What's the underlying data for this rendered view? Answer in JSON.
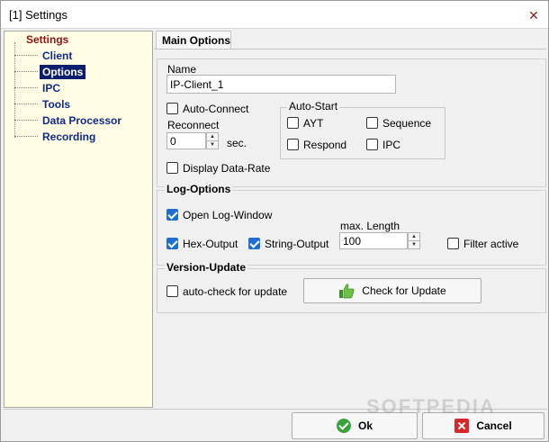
{
  "window": {
    "title": "[1] Settings"
  },
  "tree": {
    "root": "Settings",
    "items": [
      "Client",
      "Options",
      "IPC",
      "Tools",
      "Data Processor",
      "Recording"
    ],
    "selected": "Options"
  },
  "tabs": [
    {
      "label": "Main Options"
    }
  ],
  "main": {
    "name_label": "Name",
    "name_value": "IP-Client_1",
    "auto_connect": {
      "label": "Auto-Connect",
      "checked": false
    },
    "reconnect_label": "Reconnect",
    "reconnect_value": "0",
    "reconnect_unit": "sec.",
    "display_data_rate": {
      "label": "Display Data-Rate",
      "checked": false
    },
    "auto_start": {
      "title": "Auto-Start",
      "ayt": {
        "label": "AYT",
        "checked": false
      },
      "sequence": {
        "label": "Sequence",
        "checked": false
      },
      "respond": {
        "label": "Respond",
        "checked": false
      },
      "ipc": {
        "label": "IPC",
        "checked": false
      }
    }
  },
  "log": {
    "title": "Log-Options",
    "open_log_window": {
      "label": "Open Log-Window",
      "checked": true
    },
    "hex_output": {
      "label": "Hex-Output",
      "checked": true
    },
    "string_output": {
      "label": "String-Output",
      "checked": true
    },
    "max_length_label": "max. Length",
    "max_length_value": "100",
    "filter_active": {
      "label": "Filter active",
      "checked": false
    }
  },
  "update": {
    "title": "Version-Update",
    "auto_check": {
      "label": "auto-check for update",
      "checked": false
    },
    "check_button": "Check for Update"
  },
  "buttons": {
    "ok": "Ok",
    "cancel": "Cancel"
  },
  "watermark": "SOFTPEDIA",
  "colors": {
    "tree_bg": "#fffde3",
    "selection": "#0c1f6e",
    "tree_root": "#8c1414",
    "tree_item": "#102a8c",
    "checkbox_checked": "#1f6fd1"
  }
}
